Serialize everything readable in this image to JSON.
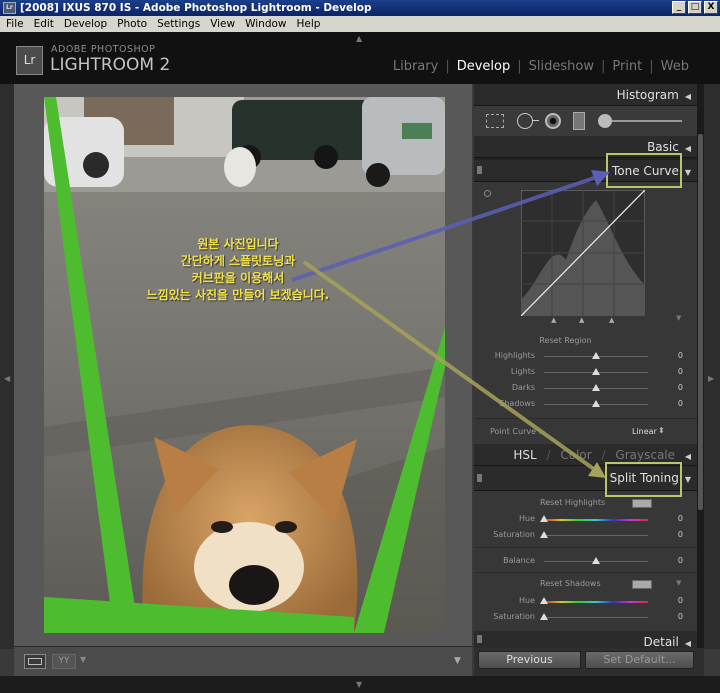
{
  "window": {
    "title": "[2008] IXUS 870 IS - Adobe Photoshop Lightroom - Develop",
    "minimize": "_",
    "maximize": "□",
    "close": "X"
  },
  "menu": [
    "File",
    "Edit",
    "Develop",
    "Photo",
    "Settings",
    "View",
    "Window",
    "Help"
  ],
  "identity": {
    "logo": "Lr",
    "brand_line1": "ADOBE PHOTOSHOP",
    "brand_line2": "LIGHTROOM 2"
  },
  "modules": [
    {
      "label": "Library",
      "active": false
    },
    {
      "label": "Develop",
      "active": true
    },
    {
      "label": "Slideshow",
      "active": false
    },
    {
      "label": "Print",
      "active": false
    },
    {
      "label": "Web",
      "active": false
    }
  ],
  "annotation": {
    "lines": [
      "원본 사진입니다",
      "간단하게 스플릿토닝과",
      "커브판을 이용해서",
      "느낌있는 사진을 만들어 보겠습니다."
    ],
    "color": "#f2e24a"
  },
  "toolbar": {
    "view_mode": "YY"
  },
  "panel": {
    "histogram": "Histogram",
    "basic": "Basic",
    "tone_curve": "Tone Curve",
    "reset_region": "Reset Region",
    "region_sliders": [
      {
        "label": "Highlights",
        "value": "0"
      },
      {
        "label": "Lights",
        "value": "0"
      },
      {
        "label": "Darks",
        "value": "0"
      },
      {
        "label": "Shadows",
        "value": "0"
      }
    ],
    "point_curve_label": "Point Curve :",
    "point_curve_value": "Linear",
    "hsl_tabs": [
      "HSL",
      "Color",
      "Grayscale"
    ],
    "split_toning": "Split Toning",
    "reset_highlights": "Reset Highlights",
    "highlight_sliders": [
      {
        "label": "Hue",
        "value": "0"
      },
      {
        "label": "Saturation",
        "value": "0"
      }
    ],
    "balance": {
      "label": "Balance",
      "value": "0"
    },
    "reset_shadows": "Reset Shadows",
    "shadow_sliders": [
      {
        "label": "Hue",
        "value": "0"
      },
      {
        "label": "Saturation",
        "value": "0"
      }
    ],
    "detail": "Detail",
    "previous_button": "Previous",
    "set_default_button": "Set Default..."
  },
  "colors": {
    "highlight_box": "#b9c76c",
    "arrow_blue": "#5b5fb5",
    "arrow_olive": "#a7a25a",
    "green_frame": "#4ebc2f"
  }
}
